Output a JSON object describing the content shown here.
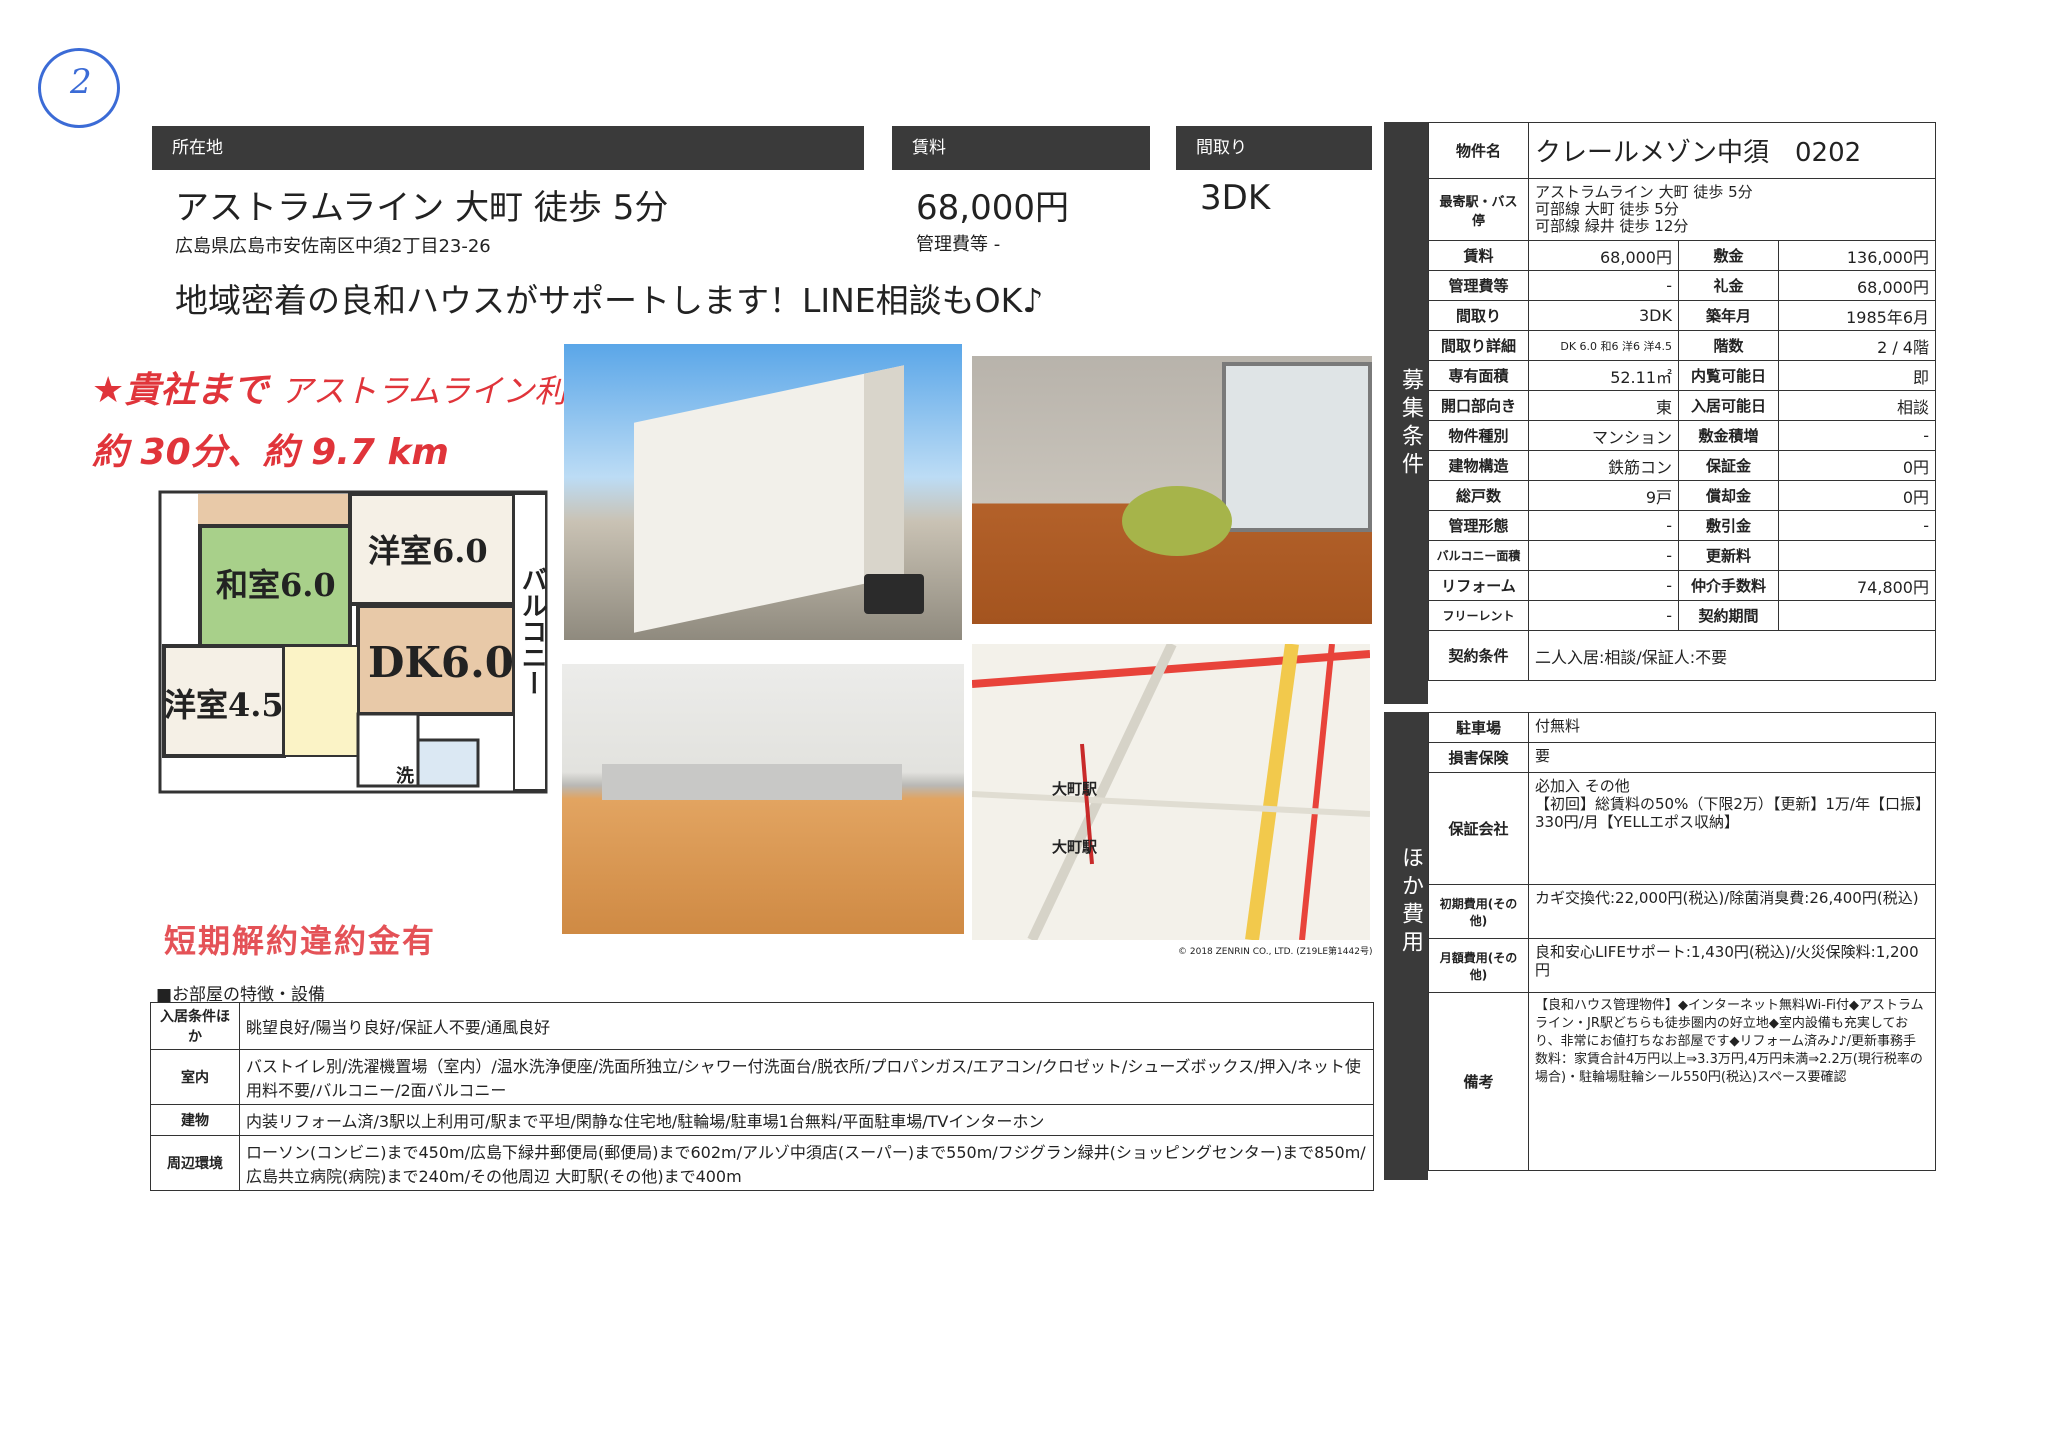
{
  "page_number": "2",
  "headers": {
    "location": "所在地",
    "rent": "賃料",
    "layout": "間取り"
  },
  "summary": {
    "station": "アストラムライン 大町 徒歩 5分",
    "address": "広島県広島市安佐南区中須2丁目23-26",
    "rent": "68,000円",
    "mgmt_fee": "管理費等 -",
    "layout": "3DK"
  },
  "tagline": "地域密着の良和ハウスがサポートします！LINE相談もOK♪",
  "handwritten": {
    "line1_a": "★貴社まで",
    "line1_b": "アストラムライン利用",
    "line2": "約 30分、約 9.7 km"
  },
  "floorplan": {
    "room1": "和室6.0",
    "room2": "洋室6.0",
    "room3": "DK6.0",
    "room4": "洋室4.5",
    "balcony": "バルコニー",
    "laundry": "洗"
  },
  "map": {
    "station1": "大町駅",
    "station2": "大町駅",
    "copyright": "© 2018 ZENRIN CO., LTD. (Z19LE第1442号)"
  },
  "stamp": "短期解約違約金有",
  "features": {
    "heading": "■お部屋の特徴・設備",
    "rows": [
      {
        "label": "入居条件ほか",
        "value": "眺望良好/陽当り良好/保証人不要/通風良好"
      },
      {
        "label": "室内",
        "value": "バストイレ別/洗濯機置場（室内）/温水洗浄便座/洗面所独立/シャワー付洗面台/脱衣所/プロパンガス/エアコン/クロゼット/シューズボックス/押入/ネット使用料不要/バルコニー/2面バルコニー"
      },
      {
        "label": "建物",
        "value": "内装リフォーム済/3駅以上利用可/駅まで平坦/閑静な住宅地/駐輪場/駐車場1台無料/平面駐車場/TVインターホン"
      },
      {
        "label": "周辺環境",
        "value": "ローソン(コンビニ)まで450m/広島下緑井郵便局(郵便局)まで602m/アルゾ中須店(スーパー)まで550m/フジグラン緑井(ショッピングセンター)まで850m/広島共立病院(病院)まで240m/その他周辺 大町駅(その他)まで400m"
      }
    ]
  },
  "side1_label": "募集条件",
  "side2_label": "ほか費用",
  "property": {
    "name_label": "物件名",
    "name": "クレールメゾン中須　0202",
    "station_label": "最寄駅・バス停",
    "station_lines": [
      "アストラムライン 大町 徒歩 5分",
      "可部線 大町 徒歩 5分",
      "可部線 緑井 徒歩 12分"
    ]
  },
  "terms": [
    {
      "l1": "賃料",
      "v1": "68,000円",
      "l2": "敷金",
      "v2": "136,000円"
    },
    {
      "l1": "管理費等",
      "v1": "-",
      "l2": "礼金",
      "v2": "68,000円"
    },
    {
      "l1": "間取り",
      "v1": "3DK",
      "l2": "築年月",
      "v2": "1985年6月"
    },
    {
      "l1": "間取り詳細",
      "v1": "DK 6.0 和6 洋6 洋4.5",
      "l2": "階数",
      "v2": "2 / 4階"
    },
    {
      "l1": "専有面積",
      "v1": "52.11㎡",
      "l2": "内覧可能日",
      "v2": "即"
    },
    {
      "l1": "開口部向き",
      "v1": "東",
      "l2": "入居可能日",
      "v2": "相談"
    },
    {
      "l1": "物件種別",
      "v1": "マンション",
      "l2": "敷金積増",
      "v2": "-"
    },
    {
      "l1": "建物構造",
      "v1": "鉄筋コン",
      "l2": "保証金",
      "v2": "0円"
    },
    {
      "l1": "総戸数",
      "v1": "9戸",
      "l2": "償却金",
      "v2": "0円"
    },
    {
      "l1": "管理形態",
      "v1": "-",
      "l2": "敷引金",
      "v2": "-"
    },
    {
      "l1": "バルコニー面積",
      "v1": "-",
      "l2": "更新料",
      "v2": ""
    },
    {
      "l1": "リフォーム",
      "v1": "-",
      "l2": "仲介手数料",
      "v2": "74,800円"
    },
    {
      "l1": "フリーレント",
      "v1": "-",
      "l2": "契約期間",
      "v2": ""
    }
  ],
  "contract": {
    "label": "契約条件",
    "value": "二人入居:相談/保証人:不要"
  },
  "costs": [
    {
      "label": "駐車場",
      "value": "付無料"
    },
    {
      "label": "損害保険",
      "value": "要"
    },
    {
      "label": "保証会社",
      "value": "必加入 その他\n【初回】総賃料の50%（下限2万）【更新】1万/年【口振】330円/月【YELLエポス収納】"
    },
    {
      "label": "初期費用(その他)",
      "value": "カギ交換代:22,000円(税込)/除菌消臭費:26,400円(税込)"
    },
    {
      "label": "月額費用(その他)",
      "value": "良和安心LIFEサポート:1,430円(税込)/火災保険料:1,200円"
    },
    {
      "label": "備考",
      "value": "【良和ハウス管理物件】◆インターネット無料Wi-Fi付◆アストラムライン・JR駅どちらも徒歩圏内の好立地◆室内設備も充実しており、非常にお値打ちなお部屋です◆リフォーム済み♪♪/更新事務手数料：家賃合計4万円以上⇒3.3万円,4万円未満⇒2.2万(現行税率の場合)・駐輪場駐輪シール550円(税込)スペース要確認"
    }
  ]
}
